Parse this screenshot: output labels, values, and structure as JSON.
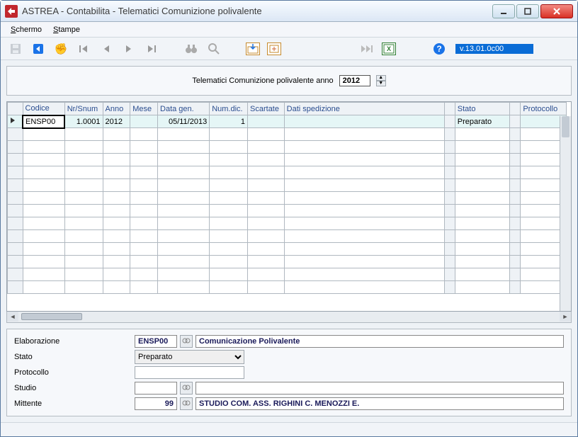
{
  "window": {
    "title": "ASTREA - Contabilita - Telematici Comunizione polivalente"
  },
  "menu": {
    "schermo": "Schermo",
    "stampe": "Stampe"
  },
  "toolbar": {
    "version": "v.13.01.0c00"
  },
  "top_panel": {
    "label": "Telematici Comunizione polivalente anno",
    "year": "2012"
  },
  "grid": {
    "headers": {
      "codice": "Codice",
      "nrsnum": "Nr/Snum",
      "anno": "Anno",
      "mese": "Mese",
      "datagen": "Data gen.",
      "numdic": "Num.dic.",
      "scartate": "Scartate",
      "datisped": "Dati spedizione",
      "stato": "Stato",
      "protocollo": "Protocollo"
    },
    "rows": [
      {
        "codice": "ENSP00",
        "nrsnum": "1.0001",
        "anno": "2012",
        "mese": "",
        "datagen": "05/11/2013",
        "numdic": "1",
        "scartate": "",
        "datisped": "",
        "stato": "Preparato",
        "protocollo": ""
      }
    ]
  },
  "detail": {
    "labels": {
      "elaborazione": "Elaborazione",
      "stato": "Stato",
      "protocollo": "Protocollo",
      "studio": "Studio",
      "mittente": "Mittente"
    },
    "elaborazione_code": "ENSP00",
    "elaborazione_desc": "Comunicazione Polivalente",
    "stato_value": "Preparato",
    "protocollo_value": "",
    "studio_code": "",
    "studio_desc": "",
    "mittente_code": "99",
    "mittente_desc": "STUDIO COM. ASS. RIGHINI C. MENOZZI E."
  }
}
